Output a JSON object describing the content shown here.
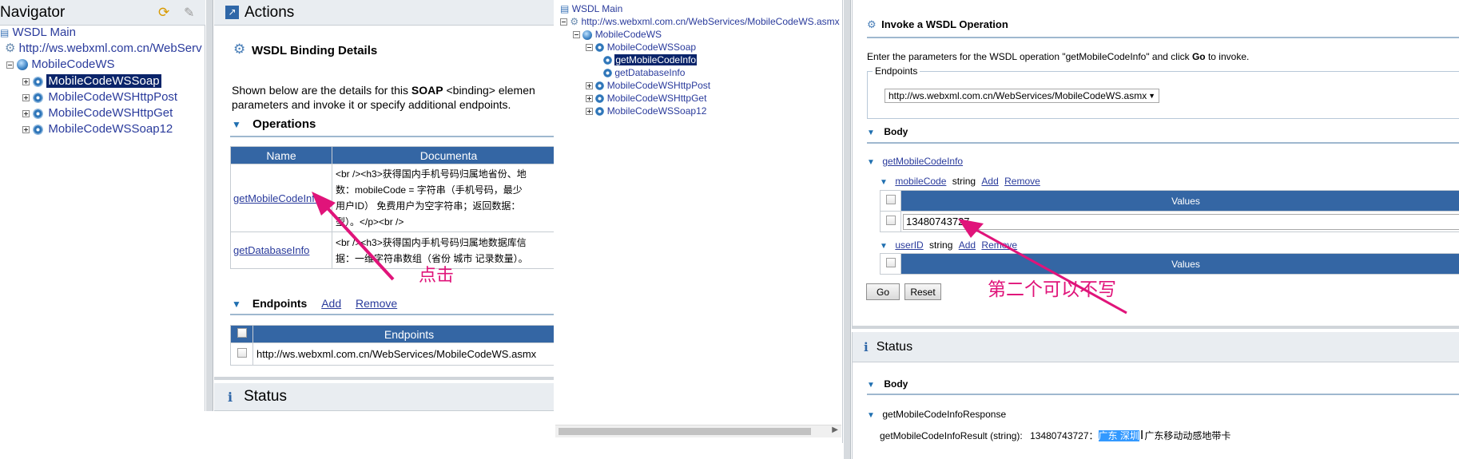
{
  "navigator": {
    "title": "Navigator",
    "wsdl_main": "WSDL Main",
    "endpoint_url": "http://ws.webxml.com.cn/WebServ",
    "service": "MobileCodeWS",
    "bindings": [
      "MobileCodeWSSoap",
      "MobileCodeWSHttpPost",
      "MobileCodeWSHttpGet",
      "MobileCodeWSSoap12"
    ]
  },
  "actions": {
    "title": "Actions",
    "section_title": "WSDL Binding Details",
    "intro_1": "Shown below are the details for this ",
    "intro_soap": "SOAP",
    "intro_2": " <binding> elemen",
    "intro_line2": "parameters and invoke it or specify additional endpoints.",
    "operations_label": "Operations",
    "col_name": "Name",
    "col_doc": "Documenta",
    "rows": [
      {
        "name": "getMobileCodeInfo",
        "doc_lines": [
          "<br /><h3>获得国内手机号码归属地省份、地",
          "数：mobileCode = 字符串（手机号码，最少",
          "用户ID） 免费用户为空字符串；返回数据：",
          "型）。</p><br />"
        ]
      },
      {
        "name": "getDatabaseInfo",
        "doc_lines": [
          "<br /><h3>获得国内手机号码归属地数据库信",
          "据：一维字符串数组（省份 城市 记录数量）。"
        ]
      }
    ],
    "annotation": "点击",
    "endpoints_label": "Endpoints",
    "add": "Add",
    "remove": "Remove",
    "endpoints_col": "Endpoints",
    "endpoint_value": "http://ws.webxml.com.cn/WebServices/MobileCodeWS.asmx"
  },
  "status_left": {
    "title": "Status"
  },
  "tree2": {
    "wsdl_main": "WSDL Main",
    "url": "http://ws.webxml.com.cn/WebServices/MobileCodeWS.asmx",
    "service": "MobileCodeWS",
    "binding_open": "MobileCodeWSSoap",
    "ops": [
      "getMobileCodeInfo",
      "getDatabaseInfo"
    ],
    "bindings_closed": [
      "MobileCodeWSHttpPost",
      "MobileCodeWSHttpGet",
      "MobileCodeWSSoap12"
    ]
  },
  "invoke": {
    "title": "Invoke a WSDL Operation",
    "intro_1": "Enter the parameters for the WSDL operation \"getMobileCodeInfo\" and click ",
    "intro_go": "Go",
    "intro_2": " to invoke.",
    "endpoints_legend": "Endpoints",
    "endpoint_selected": "http://ws.webxml.com.cn/WebServices/MobileCodeWS.asmx",
    "body_label": "Body",
    "operation": "getMobileCodeInfo",
    "param1_name": "mobileCode",
    "param1_type": "string",
    "add": "Add",
    "remove": "Remove",
    "values_header": "Values",
    "param1_value": "13480743727",
    "param2_name": "userID",
    "param2_type": "string",
    "annotation": "第二个可以不写",
    "go": "Go",
    "reset": "Reset"
  },
  "status_right": {
    "title": "Status",
    "body_label": "Body",
    "response": "getMobileCodeInfoResponse",
    "result_label": "getMobileCodeInfoResult (string):",
    "result_prefix": "13480743727：",
    "result_highlight": "广东 深圳",
    "result_suffix": "广东移动动感地带卡"
  },
  "colors": {
    "header_bg": "#e9edf1",
    "table_header": "#3466a4",
    "link": "#2a3b9c",
    "annotation": "#e0147a",
    "selection": "#0a246a"
  }
}
